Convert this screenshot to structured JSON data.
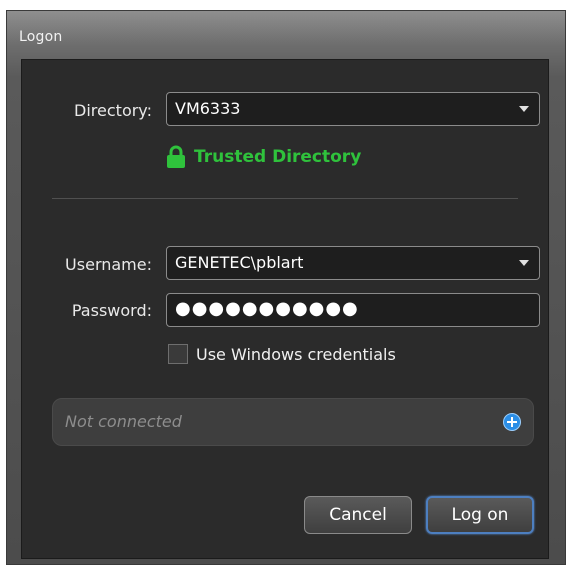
{
  "window": {
    "title": "Logon"
  },
  "form": {
    "directory_label": "Directory:",
    "directory_value": "VM6333",
    "trusted_text": "Trusted Directory",
    "username_label": "Username:",
    "username_value": "GENETEC\\pblart",
    "password_label": "Password:",
    "password_masked": "●●●●●●●●●●●",
    "use_windows_credentials_label": "Use Windows credentials",
    "use_windows_credentials_checked": false
  },
  "status": {
    "text": "Not connected"
  },
  "buttons": {
    "cancel": "Cancel",
    "logon": "Log on"
  },
  "colors": {
    "trusted_green": "#2fc23c",
    "accent_blue": "#2b8ee6",
    "panel_bg": "#2b2b2b"
  },
  "icons": {
    "trusted": "lock-icon",
    "directory_dropdown": "chevron-down-icon",
    "username_dropdown": "chevron-down-icon",
    "add_connection": "plus-circle-icon"
  }
}
